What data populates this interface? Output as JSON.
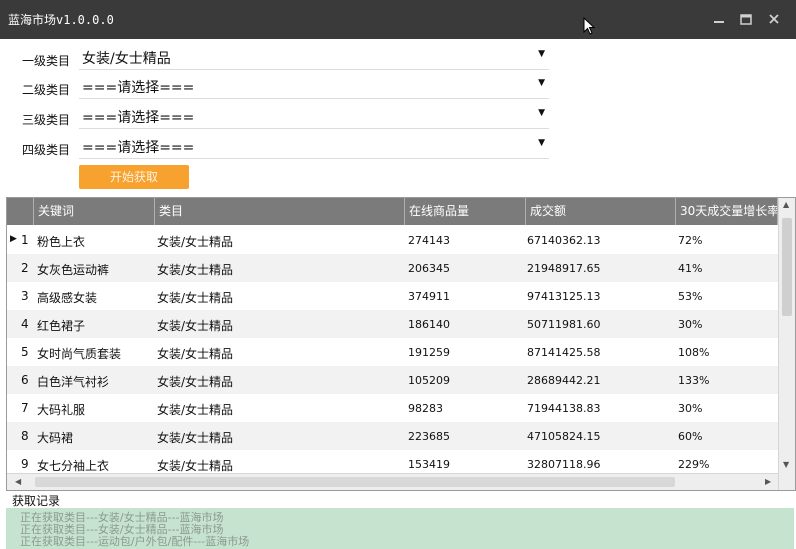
{
  "window": {
    "title": "蓝海市场v1.0.0.0",
    "controls": [
      "minimize-icon",
      "maximize-icon",
      "close-icon"
    ]
  },
  "filters": [
    {
      "label": "一级类目",
      "value": "女装/女士精品"
    },
    {
      "label": "二级类目",
      "value": "===请选择==="
    },
    {
      "label": "三级类目",
      "value": "===请选择==="
    },
    {
      "label": "四级类目",
      "value": "===请选择==="
    }
  ],
  "start_button": "开始获取",
  "table": {
    "columns": [
      "关键词",
      "类目",
      "在线商品量",
      "成交额",
      "30天成交量增长率"
    ],
    "rows": [
      {
        "n": "1",
        "keyword": "粉色上衣",
        "category": "女装/女士精品",
        "online": "274143",
        "amount": "67140362.13",
        "growth": "72%"
      },
      {
        "n": "2",
        "keyword": "女灰色运动裤",
        "category": "女装/女士精品",
        "online": "206345",
        "amount": "21948917.65",
        "growth": "41%"
      },
      {
        "n": "3",
        "keyword": "高级感女装",
        "category": "女装/女士精品",
        "online": "374911",
        "amount": "97413125.13",
        "growth": "53%"
      },
      {
        "n": "4",
        "keyword": "红色裙子",
        "category": "女装/女士精品",
        "online": "186140",
        "amount": "50711981.60",
        "growth": "30%"
      },
      {
        "n": "5",
        "keyword": "女时尚气质套装",
        "category": "女装/女士精品",
        "online": "191259",
        "amount": "87141425.58",
        "growth": "108%"
      },
      {
        "n": "6",
        "keyword": "白色洋气衬衫",
        "category": "女装/女士精品",
        "online": "105209",
        "amount": "28689442.21",
        "growth": "133%"
      },
      {
        "n": "7",
        "keyword": "大码礼服",
        "category": "女装/女士精品",
        "online": "98283",
        "amount": "71944138.83",
        "growth": "30%"
      },
      {
        "n": "8",
        "keyword": "大码裙",
        "category": "女装/女士精品",
        "online": "223685",
        "amount": "47105824.15",
        "growth": "60%"
      },
      {
        "n": "9",
        "keyword": "女七分袖上衣",
        "category": "女装/女士精品",
        "online": "153419",
        "amount": "32807118.96",
        "growth": "229%"
      }
    ]
  },
  "log": {
    "label": "获取记录",
    "lines": [
      "正在获取类目---女装/女士精品---蓝海市场",
      "正在获取类目---女装/女士精品---蓝海市场",
      "正在获取类目---运动包/户外包/配件---蓝海市场"
    ]
  }
}
